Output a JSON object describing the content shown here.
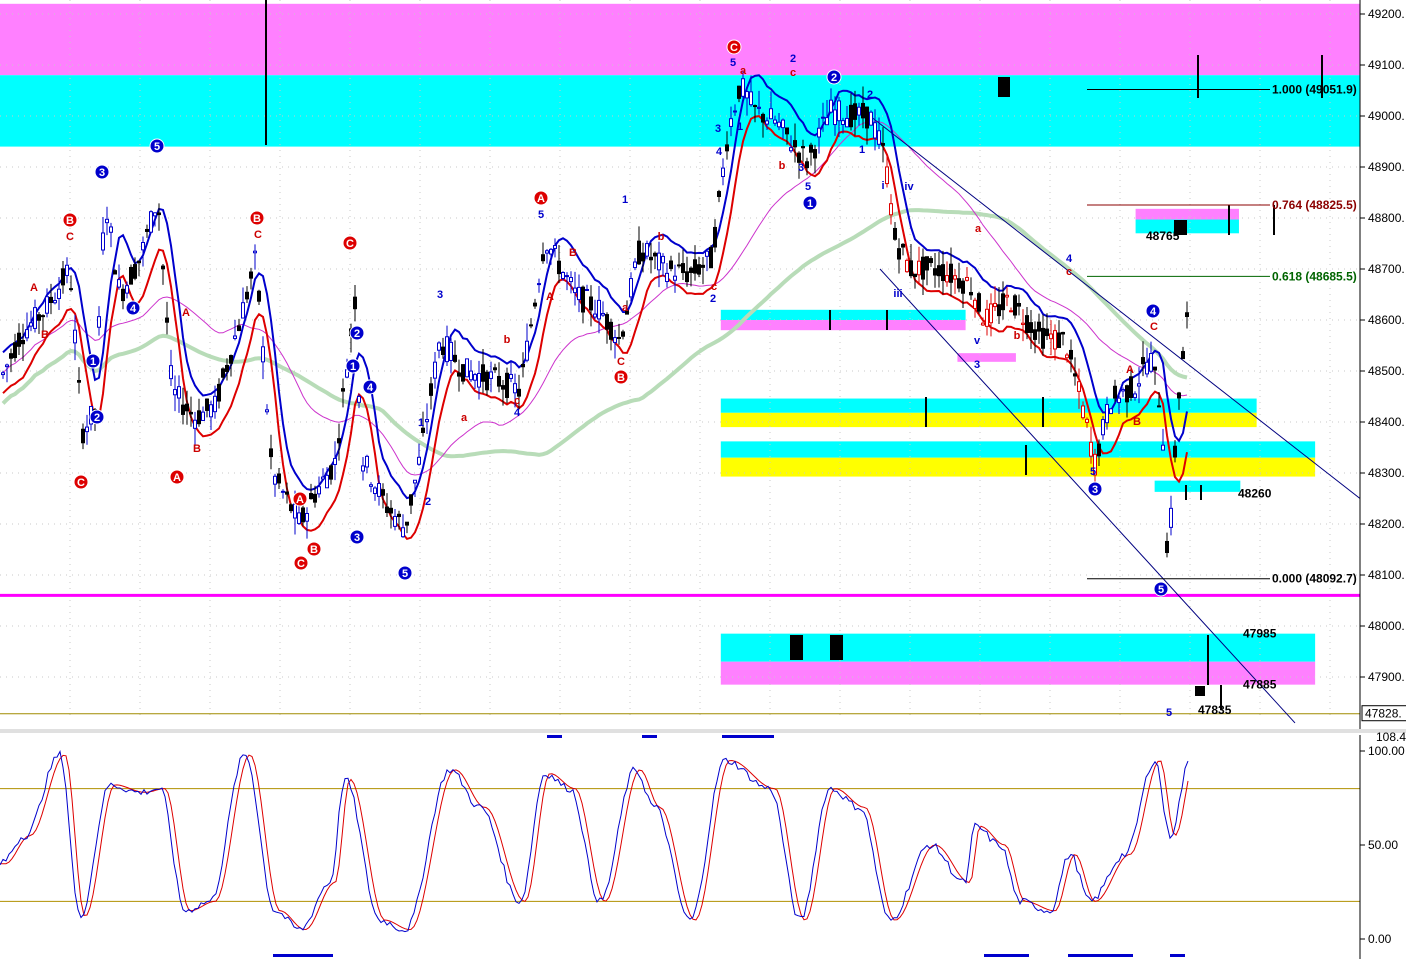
{
  "chart_data": [
    {
      "type": "candlestick",
      "panel": "price",
      "ylim": [
        47800,
        49230
      ],
      "y_ticks": [
        {
          "v": 49200,
          "label": "49200."
        },
        {
          "v": 49100,
          "label": "49100."
        },
        {
          "v": 49000,
          "label": "49000."
        },
        {
          "v": 48900,
          "label": "48900."
        },
        {
          "v": 48800,
          "label": "48800."
        },
        {
          "v": 48700,
          "label": "48700."
        },
        {
          "v": 48600,
          "label": "48600."
        },
        {
          "v": 48500,
          "label": "48500."
        },
        {
          "v": 48400,
          "label": "48400."
        },
        {
          "v": 48300,
          "label": "48300."
        },
        {
          "v": 48200,
          "label": "48200."
        },
        {
          "v": 48100,
          "label": "48100."
        },
        {
          "v": 48000,
          "label": "48000."
        },
        {
          "v": 47900,
          "label": "47900."
        }
      ],
      "last_price": {
        "v": 47828,
        "label": "47828."
      },
      "grid": true,
      "zones": [
        {
          "y0": 49220,
          "y1": 49080,
          "color": "#ff80ff"
        },
        {
          "y0": 49080,
          "y1": 48940,
          "color": "#00ffff"
        },
        {
          "y0": 48620,
          "y1": 48600,
          "color": "#00ffff",
          "x0": 0.53,
          "x1": 0.71
        },
        {
          "y0": 48600,
          "y1": 48580,
          "color": "#ff80ff",
          "x0": 0.53,
          "x1": 0.71
        },
        {
          "y0": 48446,
          "y1": 48418,
          "color": "#00ffff",
          "x0": 0.53,
          "x1": 0.924
        },
        {
          "y0": 48418,
          "y1": 48390,
          "color": "#ffff00",
          "x0": 0.53,
          "x1": 0.924
        },
        {
          "y0": 48362,
          "y1": 48330,
          "color": "#00ffff",
          "x0": 0.53,
          "x1": 0.967
        },
        {
          "y0": 48330,
          "y1": 48293,
          "color": "#ffff00",
          "x0": 0.53,
          "x1": 0.967
        },
        {
          "y0": 47985,
          "y1": 47930,
          "color": "#00ffff",
          "x0": 0.53,
          "x1": 0.967
        },
        {
          "y0": 47930,
          "y1": 47885,
          "color": "#ff80ff",
          "x0": 0.53,
          "x1": 0.967
        },
        {
          "y0": 48818,
          "y1": 48797,
          "color": "#ff80ff",
          "x0": 0.835,
          "x1": 0.911
        },
        {
          "y0": 48797,
          "y1": 48770,
          "color": "#00ffff",
          "x0": 0.835,
          "x1": 0.911
        },
        {
          "y0": 48285,
          "y1": 48263,
          "color": "#00ffff",
          "x0": 0.849,
          "x1": 0.912
        },
        {
          "y0": 48535,
          "y1": 48518,
          "color": "#ff80ff",
          "x0": 0.704,
          "x1": 0.747
        }
      ],
      "fib_levels": [
        {
          "ratio": "1.000",
          "value": "(49051.9)",
          "price": 49051.9,
          "color": "#000000"
        },
        {
          "ratio": "0.764",
          "value": "(48825.5)",
          "price": 48825.5,
          "color": "#8b0000"
        },
        {
          "ratio": "0.618",
          "value": "(48685.5)",
          "price": 48685.5,
          "color": "#006400"
        },
        {
          "ratio": "0.000",
          "value": "(48092.7)",
          "price": 48092.7,
          "color": "#000000"
        }
      ],
      "level_labels": [
        {
          "text": "48765",
          "price": 48765
        },
        {
          "text": "48260",
          "price": 48260
        },
        {
          "text": "47985",
          "price": 47985
        },
        {
          "text": "47885",
          "price": 47885
        },
        {
          "text": "47835",
          "price": 47835
        }
      ],
      "support_line": 48060,
      "wave_labels_blue": [
        "5",
        "3",
        "1",
        "2",
        "4",
        "1",
        "2",
        "4",
        "3",
        "5",
        "3",
        "1",
        "2",
        "4",
        "1",
        "5",
        "2",
        "5",
        "1",
        "2",
        "3",
        "1",
        "2",
        "1",
        "5",
        "1",
        "iii",
        "i",
        "iv",
        "v",
        "3",
        "4",
        "5",
        "3",
        "4",
        "5",
        "5"
      ],
      "wave_labels_red": [
        "B",
        "C",
        "A",
        "B",
        "C",
        "A",
        "B",
        "C",
        "C",
        "A",
        "B",
        "C",
        "B",
        "A",
        "A",
        "b",
        "c",
        "a",
        "a",
        "A",
        "B",
        "C",
        "c",
        "a",
        "b",
        "C",
        "2",
        "c",
        "b",
        "b",
        "a",
        "c",
        "A",
        "B",
        "C"
      ]
    },
    {
      "type": "line",
      "panel": "oscillator",
      "ylim": [
        0,
        100
      ],
      "y_ticks": [
        {
          "v": 100,
          "label": "100.00"
        },
        {
          "v": 50,
          "label": "50.00"
        },
        {
          "v": 0,
          "label": "0.00"
        }
      ],
      "top_value": "108.4",
      "bands": [
        80,
        20
      ]
    }
  ]
}
